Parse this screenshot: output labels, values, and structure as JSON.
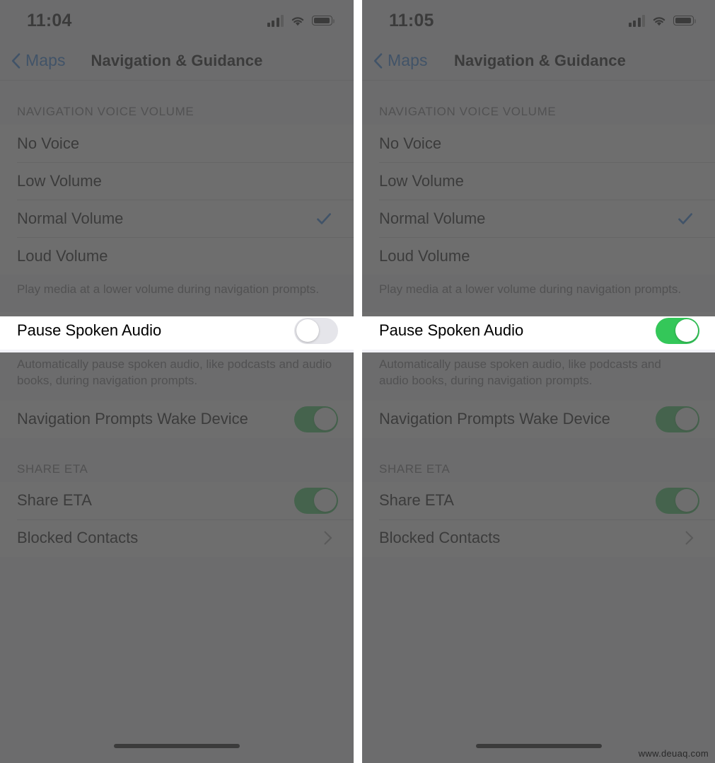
{
  "watermark": "www.deuaq.com",
  "panels": [
    {
      "id": "before",
      "status": {
        "time": "11:04",
        "signal_icon": "cellular-bars-icon",
        "wifi_icon": "wifi-icon",
        "battery_icon": "battery-icon"
      },
      "nav": {
        "back_label": "Maps",
        "back_icon": "chevron-left-icon",
        "title": "Navigation & Guidance"
      },
      "voice_section": {
        "header": "NAVIGATION VOICE VOLUME",
        "options": [
          {
            "label": "No Voice",
            "selected": false
          },
          {
            "label": "Low Volume",
            "selected": false
          },
          {
            "label": "Normal Volume",
            "selected": true
          },
          {
            "label": "Loud Volume",
            "selected": false
          }
        ],
        "footnote": "Play media at a lower volume during navigation prompts."
      },
      "pause_row": {
        "label": "Pause Spoken Audio",
        "on": false
      },
      "pause_footnote": "Automatically pause spoken audio, like podcasts and audio books, during navigation prompts.",
      "wake_row": {
        "label": "Navigation Prompts Wake Device",
        "on": true
      },
      "share_section": {
        "header": "SHARE ETA",
        "share_row": {
          "label": "Share ETA",
          "on": true
        },
        "blocked_row": {
          "label": "Blocked Contacts",
          "chevron_icon": "chevron-right-icon"
        }
      }
    },
    {
      "id": "after",
      "status": {
        "time": "11:05",
        "signal_icon": "cellular-bars-icon",
        "wifi_icon": "wifi-icon",
        "battery_icon": "battery-icon"
      },
      "nav": {
        "back_label": "Maps",
        "back_icon": "chevron-left-icon",
        "title": "Navigation & Guidance"
      },
      "voice_section": {
        "header": "NAVIGATION VOICE VOLUME",
        "options": [
          {
            "label": "No Voice",
            "selected": false
          },
          {
            "label": "Low Volume",
            "selected": false
          },
          {
            "label": "Normal Volume",
            "selected": true
          },
          {
            "label": "Loud Volume",
            "selected": false
          }
        ],
        "footnote": "Play media at a lower volume during navigation prompts."
      },
      "pause_row": {
        "label": "Pause Spoken Audio",
        "on": true
      },
      "pause_footnote": "Automatically pause spoken audio, like podcasts and audio books, during navigation prompts.",
      "wake_row": {
        "label": "Navigation Prompts Wake Device",
        "on": true
      },
      "share_section": {
        "header": "SHARE ETA",
        "share_row": {
          "label": "Share ETA",
          "on": true
        },
        "blocked_row": {
          "label": "Blocked Contacts",
          "chevron_icon": "chevron-right-icon"
        }
      }
    }
  ],
  "colors": {
    "accent_blue": "#1f7ae0",
    "toggle_on_green": "#34c759",
    "toggle_off_gray": "#e5e5ea",
    "dim_overlay": "#4a4a4a",
    "group_bg": "#f2f2f7"
  }
}
